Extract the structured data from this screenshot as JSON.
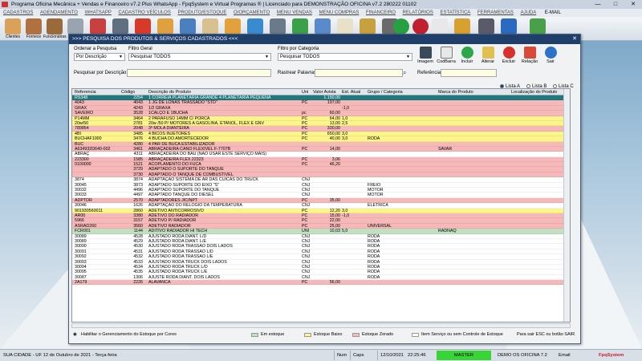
{
  "titlebar": {
    "text": "Programa Oficina Mecânica + Vendas e Financeiro v7.2 Plus WhatsApp - FpqSystem e Virtual Programas ® | Licenciado para DEMONSTRAÇÃO OFICINA v7.2 280222 01102",
    "minimize": "—",
    "maximize": "□",
    "close": "✕"
  },
  "menu": [
    "CADASTROS",
    "AGENDAMENTO",
    "WHATSAPP",
    "CADASTRO VEÍCULOS",
    "PRODUTO/ESTOQUE",
    "O/ORÇAMENTO",
    "MENU VENDAS",
    "MENU COMPRAS",
    "FINANCEIRO",
    "RELATÓRIOS",
    "ESTATÍSTICA",
    "FERRAMENTAS",
    "AJUDA"
  ],
  "menu_email": "E-MAIL",
  "toolbar_labels": [
    "Clientes",
    "Fornece",
    "Funcionárias"
  ],
  "window": {
    "title": ">>> PESQUISA DOS PRODUTOS & SERVIÇOS CADASTRADOS  <<<",
    "close": "✕"
  },
  "filters": {
    "order_label": "Ordenar a Pesquisa",
    "order_value": "Por Descrição",
    "general_label": "Filtro Geral",
    "general_value": "Pesquisar TODOS",
    "category_label": "Filtro por Categoria",
    "category_value": "Pesquisar TODOS",
    "search_label": "Pesquisar por Descrição",
    "track_label": "Rastrear Palavras",
    "reference_label": "Referência"
  },
  "buttons": [
    "Imagem",
    "CodBarra",
    "Incluir",
    "Alterar",
    "Excluir",
    "Relação",
    "Sair"
  ],
  "lists": [
    "Lista A",
    "Lista B",
    "Lista C"
  ],
  "columns": [
    "Referencia",
    "Código",
    "Descrição do Produto",
    "Uni",
    "Valor Avista",
    "Est. Atual",
    "Grupo / Categoria",
    "Marca do Produto",
    "Localização do Produto"
  ],
  "rows": [
    {
      "ref": "RS348",
      "cod": "2254",
      "desc": "1 CORREIA PLANETÁRIA GRANDE 4 PLANETÁRIA PEQUENA",
      "uni": "",
      "val": "1.150,00",
      "est": "",
      "grp": "",
      "marca": "",
      "loc": "",
      "color": "sel"
    },
    {
      "ref": "4043",
      "cod": "4043",
      "desc": "1 JG DE LONAS TRASSADO \"STD\"",
      "uni": "PC",
      "val": "197,00",
      "est": "",
      "grp": "",
      "marca": "",
      "loc": "",
      "color": "red"
    },
    {
      "ref": "GRAX",
      "cod": "4243",
      "desc": "1/2 GRAXA",
      "uni": "",
      "val": "",
      "est": "-1,0",
      "grp": "",
      "marca": "",
      "loc": "",
      "color": "red"
    },
    {
      "ref": "SAVEIRO",
      "cod": "3528",
      "desc": "1CALÇO E 1BUCHA",
      "uni": "pc",
      "val": "60,00",
      "est": "",
      "grp": "",
      "marca": "",
      "loc": "",
      "color": "red"
    },
    {
      "ref": "P14MM",
      "cod": "3464",
      "desc": "2 PARAFUSO 14MM C/ PORCA",
      "uni": "PC",
      "val": "64,00",
      "est": "1,0",
      "grp": "",
      "marca": "",
      "loc": "",
      "color": "yellow"
    },
    {
      "ref": "20w/50",
      "cod": "2781",
      "desc": "20w /50 P/ MOTORES A GASOLINA, ETANOL, FLEX E GNV",
      "uni": "PC",
      "val": "13,00",
      "est": "2,5",
      "grp": "",
      "marca": "",
      "loc": "",
      "color": "yellow"
    },
    {
      "ref": "789854",
      "cod": "2048",
      "desc": "3º MOLA DIANTEIRA",
      "uni": "PC",
      "val": "330,00",
      "est": "",
      "grp": "",
      "marca": "",
      "loc": "",
      "color": "red"
    },
    {
      "ref": "4BI",
      "cod": "3485",
      "desc": "4 BICOS INJETORES",
      "uni": "PC",
      "val": "650,00",
      "est": "3,0",
      "grp": "",
      "marca": "",
      "loc": "",
      "color": "yellow"
    },
    {
      "ref": "BUCHAF1000",
      "cod": "3476",
      "desc": "4 BUCHA DO AMORTECEDOR",
      "uni": "PC",
      "val": "40,00",
      "est": "3,0",
      "grp": "RODA",
      "marca": "",
      "loc": "",
      "color": "yellow"
    },
    {
      "ref": "BUC",
      "cod": "4280",
      "desc": "4 PAR DE BUCA ESTABILIZADOR",
      "uni": "",
      "val": "",
      "est": "",
      "grp": "",
      "marca": "",
      "loc": "",
      "color": "red"
    },
    {
      "ref": "A634932D640-002",
      "cod": "3461",
      "desc": "ABRAÇADEIRA CANO FLEXIVEL F-7707B",
      "uni": "PC",
      "val": "14,00",
      "est": "",
      "grp": "",
      "marca": "SAVAR",
      "loc": "",
      "color": "red"
    },
    {
      "ref": "ABRAÇ",
      "cod": "4311",
      "desc": "ABRAÇADEIRA DO BAÚ  (NÃO USAR ESTE SERVIÇO MAIS)",
      "uni": "",
      "val": "",
      "est": "",
      "grp": "",
      "marca": "",
      "loc": "",
      "color": "white"
    },
    {
      "ref": "223300",
      "cod": "1585",
      "desc": "ABRAÇADEIRA FLEX.22323",
      "uni": "PC",
      "val": "3,06",
      "est": "",
      "grp": "",
      "marca": "",
      "loc": "",
      "color": "red"
    },
    {
      "ref": "0100000",
      "cod": "1521",
      "desc": "ACOPLAMENTO DO FUCA",
      "uni": "PC",
      "val": "46,20",
      "est": "",
      "grp": "",
      "marca": "",
      "loc": "",
      "color": "red"
    },
    {
      "ref": "",
      "cod": "3729",
      "desc": "ADAPTADO O SUPORTE DO TANQUE",
      "uni": "",
      "val": "",
      "est": "",
      "grp": "",
      "marca": "",
      "loc": "",
      "color": "red"
    },
    {
      "ref": "",
      "cod": "3730",
      "desc": "ADAPTADO O TANQUE DE COMBUSTIVEL",
      "uni": "",
      "val": "",
      "est": "",
      "grp": "",
      "marca": "",
      "loc": "",
      "color": "red"
    },
    {
      "ref": "3874",
      "cod": "3874",
      "desc": "ADAPTAÇÃO SISTEMA DE AR DAS CUICAS DO TRUCK",
      "uni": "CNJ",
      "val": "",
      "est": "",
      "grp": "",
      "marca": "",
      "loc": "",
      "color": "white"
    },
    {
      "ref": "30045",
      "cod": "3873",
      "desc": "ADAPTADO SUPORTE DO EIXO \"S\"",
      "uni": "CNJ",
      "val": "",
      "est": "",
      "grp": "FREIO",
      "marca": "",
      "loc": "",
      "color": "white"
    },
    {
      "ref": "30032",
      "cod": "4496",
      "desc": "ADAPTADO SUPORTE DO TANQUE",
      "uni": "CNJ",
      "val": "",
      "est": "",
      "grp": "MOTOR",
      "marca": "",
      "loc": "",
      "color": "white"
    },
    {
      "ref": "30033",
      "cod": "4497",
      "desc": "ADAPTADO TANQUE DO DIESEL",
      "uni": "CNJ",
      "val": "",
      "est": "",
      "grp": "MOTOR",
      "marca": "",
      "loc": "",
      "color": "white"
    },
    {
      "ref": "ADPTDR",
      "cod": "2570",
      "desc": "ADAPTADORES JIC/NPT",
      "uni": "PC",
      "val": "35,00",
      "est": "",
      "grp": "",
      "marca": "",
      "loc": "",
      "color": "red"
    },
    {
      "ref": "30046",
      "cod": "1626",
      "desc": "ADAPTAÇÃO DO RELOGIO DA TEMPERATURA",
      "uni": "CNJ",
      "val": "",
      "est": "",
      "grp": "ELÉTRICA",
      "marca": "",
      "loc": "",
      "color": "white"
    },
    {
      "ref": "901930560011",
      "cod": "2860",
      "desc": "ADETIVO ANTICORROSIVO",
      "uni": "PC",
      "val": "12,20",
      "est": "3,0",
      "grp": "",
      "marca": "",
      "loc": "",
      "color": "yellow"
    },
    {
      "ref": "AR00",
      "cod": "3380",
      "desc": "ADETIVO DO RADIADOR",
      "uni": "PC",
      "val": "15,00",
      "est": "-1,0",
      "grp": "",
      "marca": "",
      "loc": "",
      "color": "red"
    },
    {
      "ref": "5966",
      "cod": "3157",
      "desc": "ADETIVO P/ RADIADOR",
      "uni": "PC",
      "val": "22,00",
      "est": "",
      "grp": "",
      "marca": "",
      "loc": "",
      "color": "red"
    },
    {
      "ref": "ASRAD260",
      "cod": "3560",
      "desc": "ADETIVO RADIADOR",
      "uni": "PC",
      "val": "25,00",
      "est": "",
      "grp": "UNIVERSAL",
      "marca": "",
      "loc": "",
      "color": "red"
    },
    {
      "ref": "FCR001",
      "cod": "1144",
      "desc": "ADITIVO RADIADOR HI TECH",
      "uni": "UNI",
      "val": "10,03",
      "est": "5,0",
      "grp": "",
      "marca": "RADNAQ",
      "loc": "",
      "color": "green"
    },
    {
      "ref": "30089",
      "cod": "4528",
      "desc": "AJUSTADO RODA DIANT. L/D",
      "uni": "CNJ",
      "val": "",
      "est": "",
      "grp": "RODA",
      "marca": "",
      "loc": "",
      "color": "white"
    },
    {
      "ref": "30089",
      "cod": "4529",
      "desc": "AJUSTADO RODA DIANT. L/E",
      "uni": "CNJ",
      "val": "",
      "est": "",
      "grp": "RODA",
      "marca": "",
      "loc": "",
      "color": "white"
    },
    {
      "ref": "30090",
      "cod": "4530",
      "desc": "AJUSTADO RODA TRASSÃO DOIS LADOS",
      "uni": "CNJ",
      "val": "",
      "est": "",
      "grp": "RODA",
      "marca": "",
      "loc": "",
      "color": "white"
    },
    {
      "ref": "30091",
      "cod": "4531",
      "desc": "AJUSTADO RODA TRASSÃO L/D",
      "uni": "CNJ",
      "val": "",
      "est": "",
      "grp": "RODA",
      "marca": "",
      "loc": "",
      "color": "white"
    },
    {
      "ref": "30092",
      "cod": "4532",
      "desc": "AJUSTADO RODA TRASSÃO L/E",
      "uni": "CNJ",
      "val": "",
      "est": "",
      "grp": "RODA",
      "marca": "",
      "loc": "",
      "color": "white"
    },
    {
      "ref": "30093",
      "cod": "4533",
      "desc": "AJUSTADO RODA TRUCK DOIS LADOS",
      "uni": "CNJ",
      "val": "",
      "est": "",
      "grp": "RODA",
      "marca": "",
      "loc": "",
      "color": "white"
    },
    {
      "ref": "30094",
      "cod": "4534",
      "desc": "AJUSTADO RODA TRUCK L/D",
      "uni": "CNJ",
      "val": "",
      "est": "",
      "grp": "RODA",
      "marca": "",
      "loc": "",
      "color": "white"
    },
    {
      "ref": "30095",
      "cod": "4535",
      "desc": "AJUSTADO RODA TRUCK L/E",
      "uni": "CNJ",
      "val": "",
      "est": "",
      "grp": "RODA",
      "marca": "",
      "loc": "",
      "color": "white"
    },
    {
      "ref": "30087",
      "cod": "1306",
      "desc": "AJUSTE RODA DIANT.  DOIS LADOS",
      "uni": "CNJ",
      "val": "",
      "est": "",
      "grp": "RODA",
      "marca": "",
      "loc": "",
      "color": "white"
    },
    {
      "ref": "2A179",
      "cod": "2226",
      "desc": "ALAVANCA",
      "uni": "PC",
      "val": "56,00",
      "est": "",
      "grp": "",
      "marca": "",
      "loc": "",
      "color": "red"
    }
  ],
  "legend": {
    "enable": "Habilitar o Gerenciamento do Estoque por Cores",
    "in_stock": "Em estoque",
    "low": "Estoque Baixo",
    "zero": "Estoque Zerado",
    "service": "Item Serviço ou sem Controle de Estoque",
    "exit": "Para sair ESC ou botão SAIR"
  },
  "status": {
    "city": "SUA CIDADE - UF 12 de Outubro de 2021 - Terça-feira",
    "num": "Num",
    "caps": "Caps",
    "date": "12/10/2021",
    "time": "22:25:46",
    "master": "MASTER",
    "demo": "DEMO OS OFICINA 7.2",
    "email": "Email",
    "brand": "FpqSystem"
  },
  "colors": {
    "sel": "#1d7a7e",
    "red": "#f6b8b8",
    "yellow": "#fbf58a",
    "green": "#c2dfc2",
    "white": "#ffffff"
  }
}
